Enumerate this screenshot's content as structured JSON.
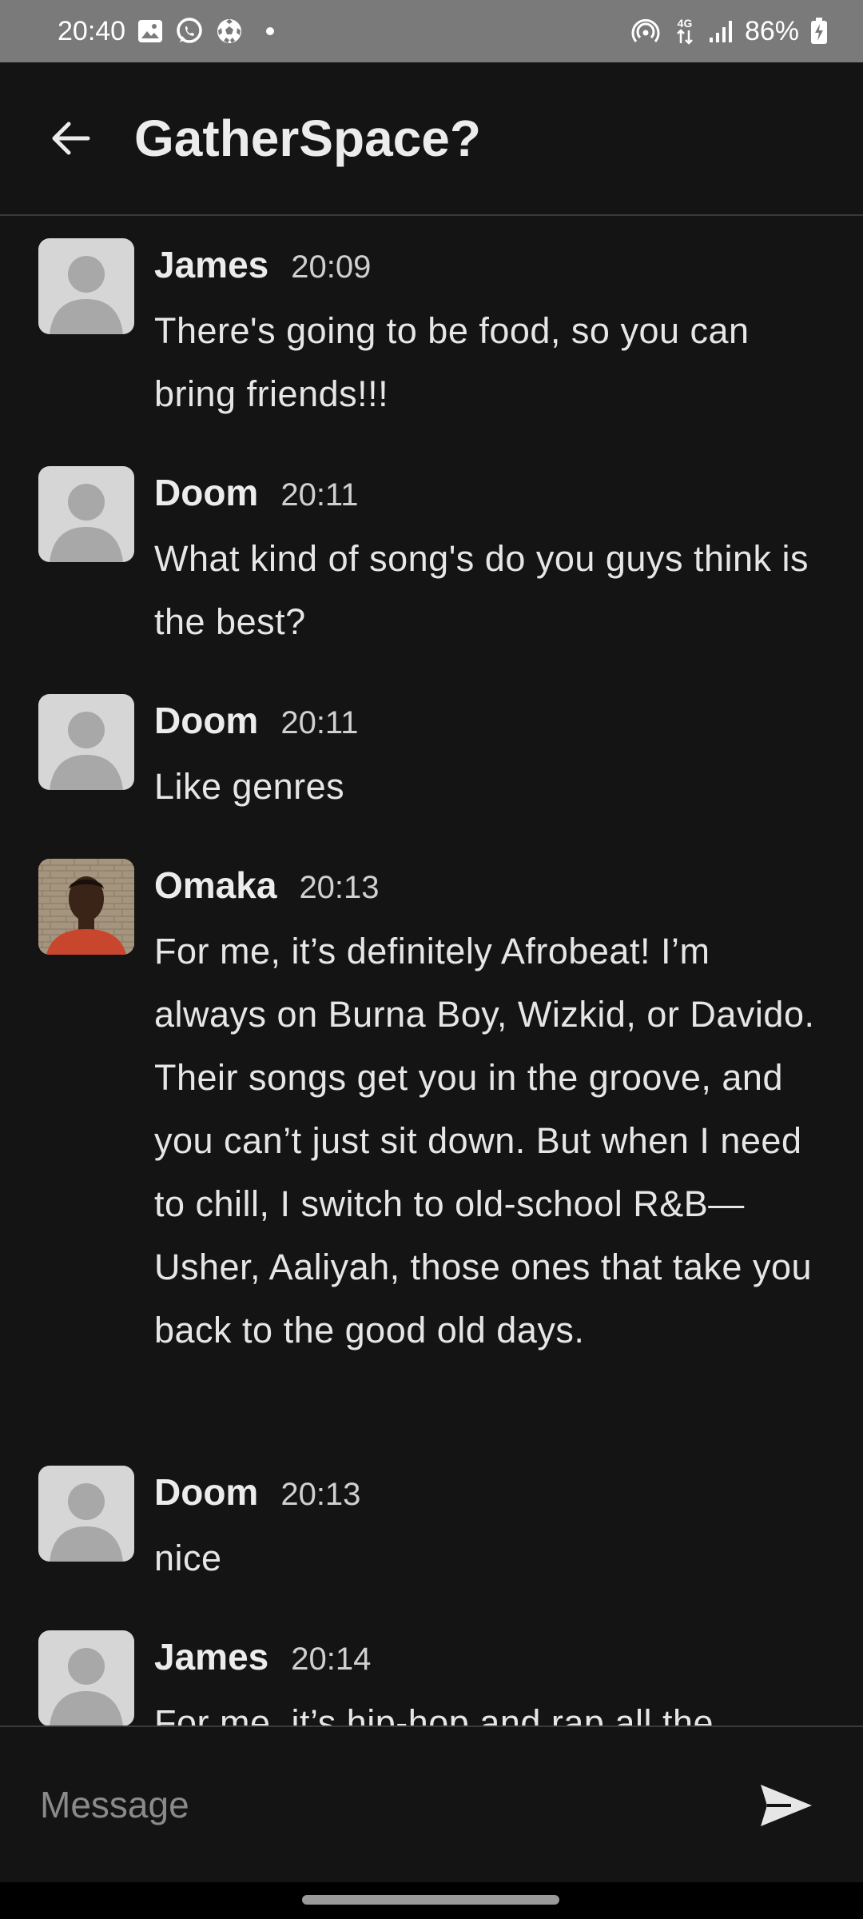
{
  "status_bar": {
    "time": "20:40",
    "left_icons": [
      "gallery-icon",
      "whatsapp-icon",
      "soccer-ball-icon",
      "dot-icon"
    ],
    "right_icons": [
      "hotspot-icon",
      "network-4g-icon",
      "signal-bars-icon",
      "battery-charging-icon"
    ],
    "network": "4G",
    "battery": "86%"
  },
  "header": {
    "back_icon": "arrow-left-icon",
    "title": "GatherSpace?"
  },
  "messages": [
    {
      "sender": "James",
      "time": "20:09",
      "avatar": "default-avatar",
      "text": "There's going to be food, so you can bring friends!!!"
    },
    {
      "sender": "Doom",
      "time": "20:11",
      "avatar": "default-avatar",
      "text": "What kind of song's do you guys think is the best?"
    },
    {
      "sender": "Doom",
      "time": "20:11",
      "avatar": "default-avatar",
      "text": "Like genres"
    },
    {
      "sender": "Omaka",
      "time": "20:13",
      "avatar": "photo-avatar",
      "text": "For me, it’s definitely Afrobeat! I’m always on Burna Boy, Wizkid, or Davido. Their songs get you in the groove, and you can’t just sit down. But when I need to chill, I switch to old-school R&B—Usher, Aaliyah, those ones that take you back to the good old days."
    },
    {
      "sender": "Doom",
      "time": "20:13",
      "avatar": "default-avatar",
      "text": "nice"
    },
    {
      "sender": "James",
      "time": "20:14",
      "avatar": "default-avatar",
      "text": "For me, it’s hip-hop and rap all the"
    }
  ],
  "composer": {
    "placeholder": "Message",
    "send_icon": "send-icon"
  },
  "colors": {
    "background": "#141414",
    "status_bar": "#7a7a7a",
    "divider": "#3a3a3a",
    "avatar_bg": "#d6d6d6",
    "avatar_fg": "#a8a8a8"
  }
}
